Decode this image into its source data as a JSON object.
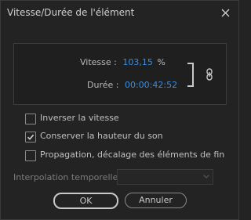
{
  "window": {
    "title": "Vitesse/Durée de l'élément"
  },
  "speed": {
    "label": "Vitesse :",
    "value": "103,15",
    "unit": "%"
  },
  "duration": {
    "label": "Durée :",
    "value": "00:00:42:52"
  },
  "options": [
    {
      "label": "Inverser la vitesse",
      "checked": false
    },
    {
      "label": "Conserver la hauteur du son",
      "checked": true
    },
    {
      "label": "Propagation, décalage des éléments de fin",
      "checked": false
    }
  ],
  "interpolation": {
    "label": "Interpolation temporelle :",
    "value": ""
  },
  "buttons": {
    "ok": "OK",
    "cancel": "Annuler"
  },
  "colors": {
    "value_blue": "#3a8de0",
    "background": "#232323"
  }
}
